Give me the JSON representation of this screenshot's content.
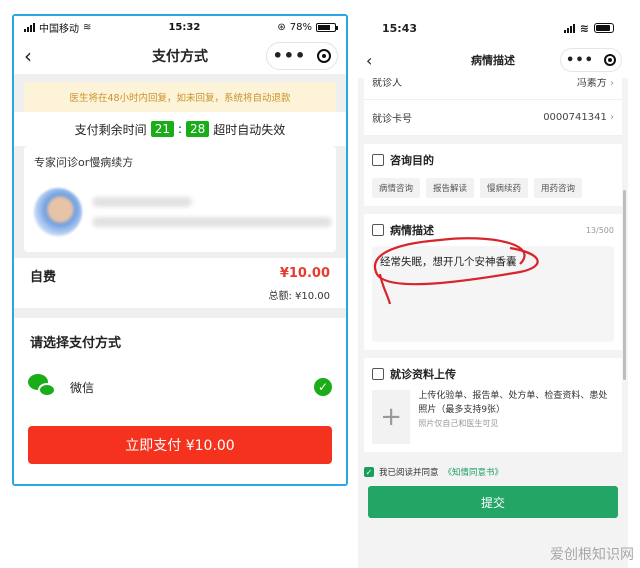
{
  "left": {
    "status": {
      "carrier": "中国移动",
      "time": "15:32",
      "battery": "78%"
    },
    "nav": {
      "back": "‹",
      "title": "支付方式"
    },
    "notice": "医生将在48小时内回复，如未回复，系统将自动退款",
    "countdown": {
      "prefix": "支付剩余时间",
      "minutes": "21",
      "sep": ":",
      "seconds": "28",
      "suffix": "超时自动失效"
    },
    "service": "专家问诊or慢病续方",
    "fee": {
      "label": "自费",
      "price": "¥10.00",
      "total": "总额: ¥10.00"
    },
    "payment": {
      "heading": "请选择支付方式",
      "method": "微信",
      "button": "立即支付 ¥10.00"
    }
  },
  "right": {
    "status": {
      "time": "15:43"
    },
    "nav": {
      "back": "‹",
      "title": "病情描述"
    },
    "patient": {
      "label": "就诊人",
      "value": "冯素方"
    },
    "card": {
      "label": "就诊卡号",
      "value": "0000741341"
    },
    "purpose": {
      "heading": "咨询目的",
      "tags": [
        "病情咨询",
        "报告解读",
        "慢病续药",
        "用药咨询"
      ]
    },
    "description": {
      "heading": "病情描述",
      "count": "13/500",
      "text": "经常失眠，想开几个安神香囊"
    },
    "upload": {
      "heading": "就诊资料上传",
      "text": "上传化验单、报告单、处方单、检查资料、患处照片（最多支持9张）",
      "note": "照片仅自己和医生可见"
    },
    "agree": {
      "text": "我已阅读并同意",
      "link": "《知情同意书》"
    },
    "submit": "提交"
  },
  "watermark": "爱创根知识网",
  "colors": {
    "green": "#1aad19",
    "red": "#f4321e",
    "submit_green": "#22a565"
  }
}
